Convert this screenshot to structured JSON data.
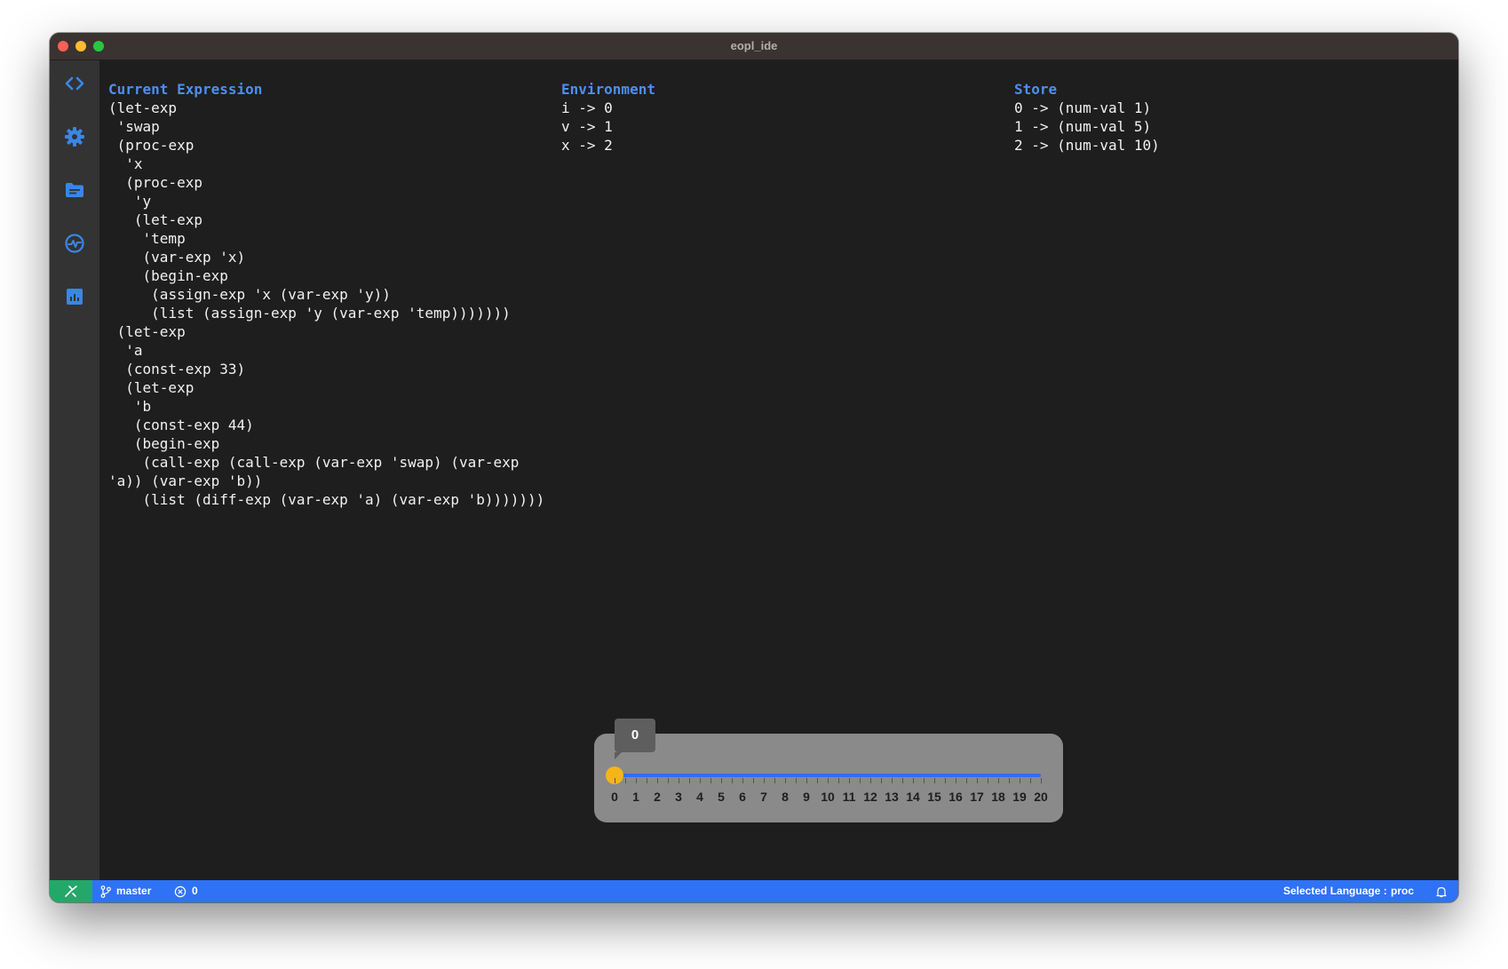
{
  "window": {
    "title": "eopl_ide"
  },
  "activity_bar": {
    "icons": [
      "code-icon",
      "gear-icon",
      "folder-icon",
      "activity-monitor-icon",
      "chart-icon"
    ],
    "accent": "#3a86e8"
  },
  "panes": {
    "expression": {
      "title": "Current Expression",
      "body": "(let-exp\n 'swap\n (proc-exp\n  'x\n  (proc-exp\n   'y\n   (let-exp\n    'temp\n    (var-exp 'x)\n    (begin-exp\n     (assign-exp 'x (var-exp 'y))\n     (list (assign-exp 'y (var-exp 'temp)))))))\n (let-exp\n  'a\n  (const-exp 33)\n  (let-exp\n   'b\n   (const-exp 44)\n   (begin-exp\n    (call-exp (call-exp (var-exp 'swap) (var-exp 'a)) (var-exp 'b))\n    (list (diff-exp (var-exp 'a) (var-exp 'b)))))))"
    },
    "environment": {
      "title": "Environment",
      "body": "i -> 0\nv -> 1\nx -> 2"
    },
    "store": {
      "title": "Store",
      "body": "0 -> (num-val 1)\n1 -> (num-val 5)\n2 -> (num-val 10)"
    }
  },
  "slider": {
    "value": 0,
    "value_label": "0",
    "min": 0,
    "max": 20,
    "labels": [
      "0",
      "1",
      "2",
      "3",
      "4",
      "5",
      "6",
      "7",
      "8",
      "9",
      "10",
      "11",
      "12",
      "13",
      "14",
      "15",
      "16",
      "17",
      "18",
      "19",
      "20"
    ],
    "thumb_color": "#f4b516",
    "track_color": "#2f6ff0"
  },
  "statusbar": {
    "branch": "master",
    "errors": "0",
    "language_label": "Selected Language :",
    "language": "proc",
    "background": "#2f72f5"
  }
}
